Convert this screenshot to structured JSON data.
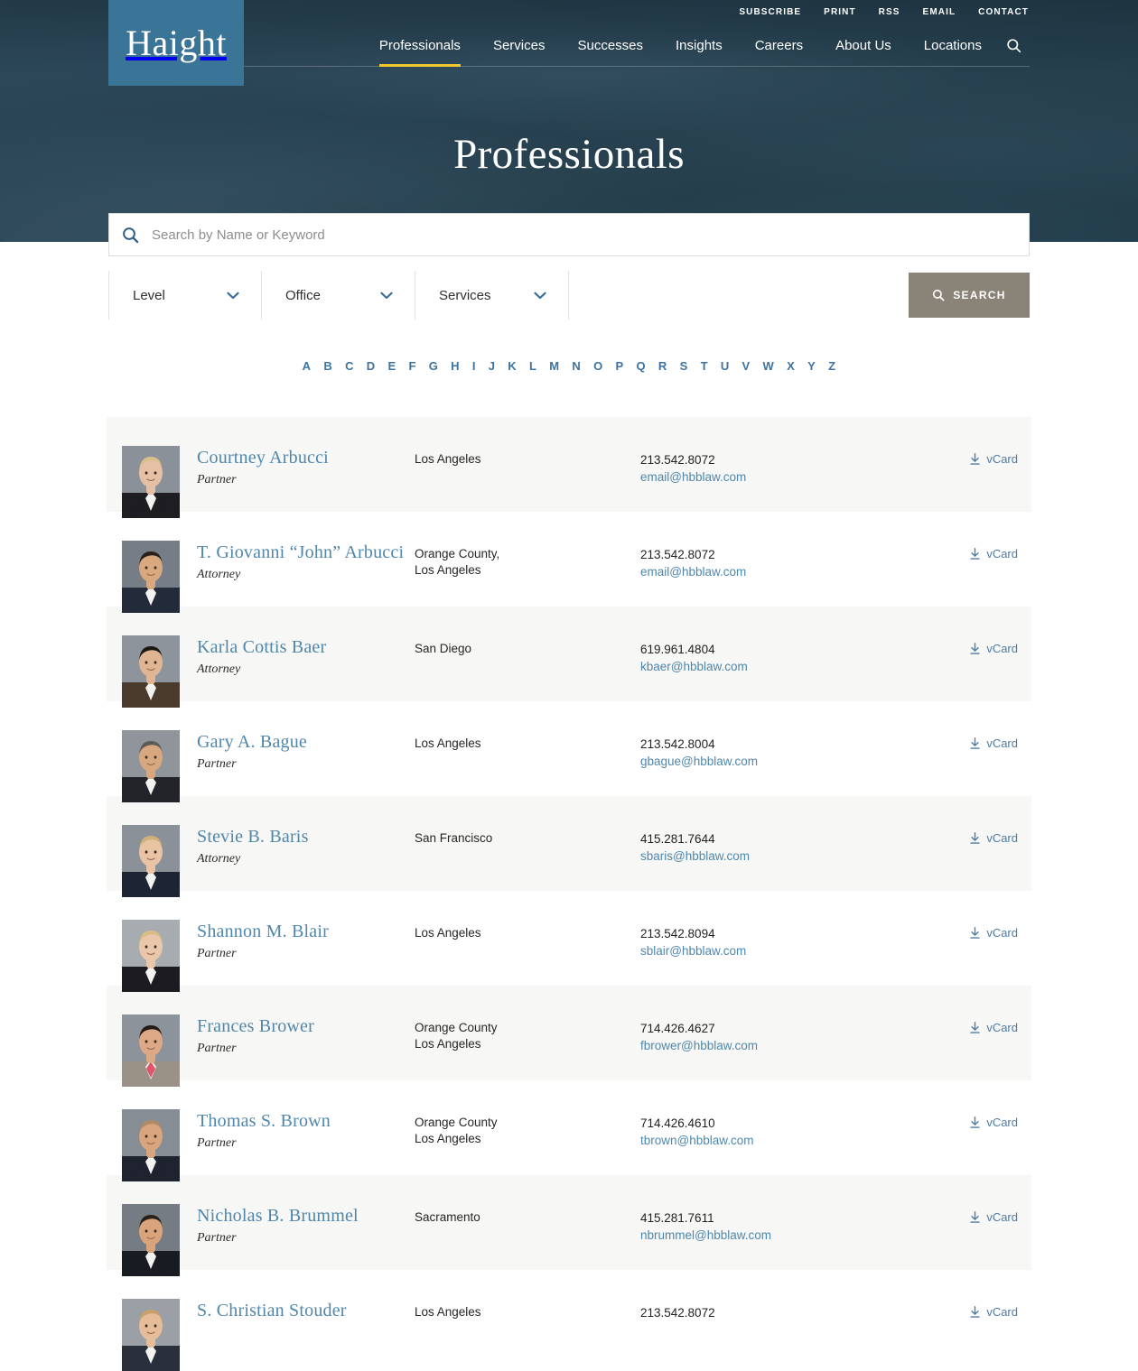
{
  "brand": {
    "logo_text": "Haight",
    "logo_bg": "#3a7497"
  },
  "utility_nav": [
    {
      "label": "SUBSCRIBE"
    },
    {
      "label": "PRINT"
    },
    {
      "label": "RSS"
    },
    {
      "label": "EMAIL"
    },
    {
      "label": "CONTACT"
    }
  ],
  "main_nav": {
    "items": [
      {
        "label": "Professionals",
        "active": true
      },
      {
        "label": "Services",
        "active": false
      },
      {
        "label": "Successes",
        "active": false
      },
      {
        "label": "Insights",
        "active": false
      },
      {
        "label": "Careers",
        "active": false
      },
      {
        "label": "About Us",
        "active": false
      },
      {
        "label": "Locations",
        "active": false
      }
    ],
    "search_icon": "search-icon",
    "active_underline_color": "#f0c930"
  },
  "hero": {
    "title": "Professionals",
    "bg_color": "#2a4656"
  },
  "search": {
    "placeholder": "Search by Name or Keyword",
    "value": "",
    "icon": "search-icon"
  },
  "filters": {
    "dropdowns": [
      {
        "label": "Level",
        "icon": "chevron-down-icon"
      },
      {
        "label": "Office",
        "icon": "chevron-down-icon"
      },
      {
        "label": "Services",
        "icon": "chevron-down-icon"
      }
    ],
    "search_button": {
      "label": "SEARCH",
      "icon": "search-icon",
      "color": "#8a8378"
    }
  },
  "alphabet": [
    "A",
    "B",
    "C",
    "D",
    "E",
    "F",
    "G",
    "H",
    "I",
    "J",
    "K",
    "L",
    "M",
    "N",
    "O",
    "P",
    "Q",
    "R",
    "S",
    "T",
    "U",
    "V",
    "W",
    "X",
    "Y",
    "Z"
  ],
  "listing": {
    "vcard_label": "vCard",
    "vcard_icon": "download-icon",
    "rows": [
      {
        "name": "Courtney Arbucci",
        "title": "Partner",
        "offices": [
          "Los Angeles"
        ],
        "phone": "213.542.8072",
        "email": "email@hbblaw.com",
        "photo": {
          "skin": "#e6c0a4",
          "hair": "#d8c08a",
          "suit": "#1d1d22",
          "bg": "#8b9199"
        }
      },
      {
        "name": "T. Giovanni “John” Arbucci",
        "title": "Attorney",
        "offices": [
          "Orange County,",
          "Los Angeles"
        ],
        "phone": "213.542.8072",
        "email": "email@hbblaw.com",
        "photo": {
          "skin": "#d8a87e",
          "hair": "#2b2119",
          "suit": "#232a3a",
          "bg": "#767d86"
        }
      },
      {
        "name": "Karla Cottis Baer",
        "title": "Attorney",
        "offices": [
          "San Diego"
        ],
        "phone": "619.961.4804",
        "email": "kbaer@hbblaw.com",
        "photo": {
          "skin": "#e0b593",
          "hair": "#1d1712",
          "suit": "#4a3b2c",
          "bg": "#8d949c"
        }
      },
      {
        "name": "Gary A. Bague",
        "title": "Partner",
        "offices": [
          "Los Angeles"
        ],
        "phone": "213.542.8004",
        "email": "gbague@hbblaw.com",
        "photo": {
          "skin": "#d7a87f",
          "hair": "#5b5a58",
          "suit": "#23242a",
          "bg": "#8f959b"
        }
      },
      {
        "name": "Stevie B. Baris",
        "title": "Attorney",
        "offices": [
          "San Francisco"
        ],
        "phone": "415.281.7644",
        "email": "sbaris@hbblaw.com",
        "photo": {
          "skin": "#e8c3a4",
          "hair": "#cfb07a",
          "suit": "#1d2433",
          "bg": "#8b9199"
        }
      },
      {
        "name": "Shannon M. Blair",
        "title": "Partner",
        "offices": [
          "Los Angeles"
        ],
        "phone": "213.542.8094",
        "email": "sblair@hbblaw.com",
        "photo": {
          "skin": "#eac7aa",
          "hair": "#d9bd84",
          "suit": "#1c1c20",
          "bg": "#a7acb1"
        }
      },
      {
        "name": "Frances Brower",
        "title": "Partner",
        "offices": [
          "Orange County",
          "Los Angeles"
        ],
        "phone": "714.426.4627",
        "email": "fbrower@hbblaw.com",
        "photo": {
          "skin": "#dda886",
          "hair": "#241a14",
          "suit": "#9a9287",
          "bg": "#8d939b",
          "accent": "#e0536a"
        }
      },
      {
        "name": "Thomas S. Brown",
        "title": "Partner",
        "offices": [
          "Orange County",
          "Los Angeles"
        ],
        "phone": "714.426.4610",
        "email": "tbrown@hbblaw.com",
        "photo": {
          "skin": "#d9a57e",
          "hair": "#b08a64",
          "suit": "#1f2330",
          "bg": "#878d95"
        }
      },
      {
        "name": "Nicholas B. Brummel",
        "title": "Partner",
        "offices": [
          "Sacramento"
        ],
        "phone": "415.281.7611",
        "email": "nbrummel@hbblaw.com",
        "photo": {
          "skin": "#d9a47c",
          "hair": "#2a2018",
          "suit": "#191b22",
          "bg": "#767c84"
        }
      },
      {
        "name": "S. Christian Stouder",
        "title": "",
        "offices": [
          "Los Angeles"
        ],
        "phone": "213.542.8072",
        "email": "",
        "photo": {
          "skin": "#e6bd99",
          "hair": "#c9a06a",
          "suit": "#2a2f3c",
          "bg": "#9aa0a6"
        }
      }
    ]
  }
}
